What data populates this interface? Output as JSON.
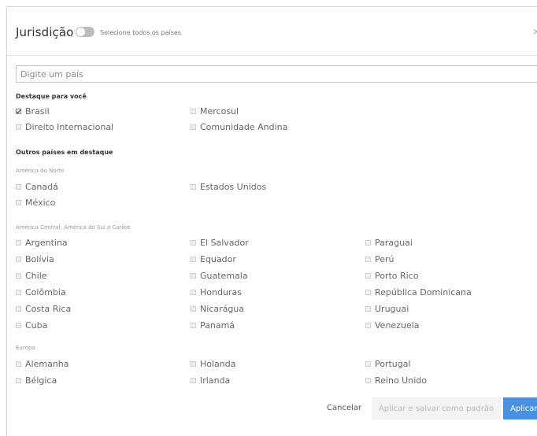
{
  "header": {
    "title": "Jurisdição",
    "toggle_label": "Selecione todos os países",
    "toggle_on": false,
    "close_symbol": "×"
  },
  "search": {
    "placeholder": "Digite um país",
    "value": ""
  },
  "featured": {
    "title": "Destaque para você",
    "items": [
      {
        "label": "Brasil",
        "checked": true
      },
      {
        "label": "Mercosul",
        "checked": false
      },
      {
        "label": "Direito Internacional",
        "checked": false
      },
      {
        "label": "Comunidade Andina",
        "checked": false
      }
    ]
  },
  "others": {
    "title": "Outros países em destaque",
    "north_america": {
      "title": "América do Norte",
      "items": [
        {
          "label": "Canadá",
          "checked": false
        },
        {
          "label": "Estados Unidos",
          "checked": false
        },
        {
          "label": "México",
          "checked": false
        }
      ]
    },
    "latin_america": {
      "title": "América Central, América do Sul e Caribe",
      "items": [
        {
          "label": "Argentina",
          "checked": false
        },
        {
          "label": "El Salvador",
          "checked": false
        },
        {
          "label": "Paraguai",
          "checked": false
        },
        {
          "label": "Bolívia",
          "checked": false
        },
        {
          "label": "Equador",
          "checked": false
        },
        {
          "label": "Perú",
          "checked": false
        },
        {
          "label": "Chile",
          "checked": false
        },
        {
          "label": "Guatemala",
          "checked": false
        },
        {
          "label": "Porto Rico",
          "checked": false
        },
        {
          "label": "Colômbia",
          "checked": false
        },
        {
          "label": "Honduras",
          "checked": false
        },
        {
          "label": "República Dominicana",
          "checked": false
        },
        {
          "label": "Costa Rica",
          "checked": false
        },
        {
          "label": "Nicarágua",
          "checked": false
        },
        {
          "label": "Uruguai",
          "checked": false
        },
        {
          "label": "Cuba",
          "checked": false
        },
        {
          "label": "Panamá",
          "checked": false
        },
        {
          "label": "Venezuela",
          "checked": false
        }
      ]
    },
    "europe": {
      "title": "Europa",
      "items": [
        {
          "label": "Alemanha",
          "checked": false
        },
        {
          "label": "Holanda",
          "checked": false
        },
        {
          "label": "Portugal",
          "checked": false
        },
        {
          "label": "Bélgica",
          "checked": false
        },
        {
          "label": "Irlanda",
          "checked": false
        },
        {
          "label": "Reino Unido",
          "checked": false
        }
      ]
    }
  },
  "footer": {
    "cancel_label": "Cancelar",
    "save_default_label": "Aplicar e salvar como padrão",
    "apply_label": "Aplicar"
  },
  "colors": {
    "primary": "#4a90e2",
    "toggle_off": "#bcbcbc",
    "disabled_button_bg": "#f3f3f3"
  },
  "icons": {
    "close": "close-icon",
    "checkbox": "checkbox-icon"
  }
}
